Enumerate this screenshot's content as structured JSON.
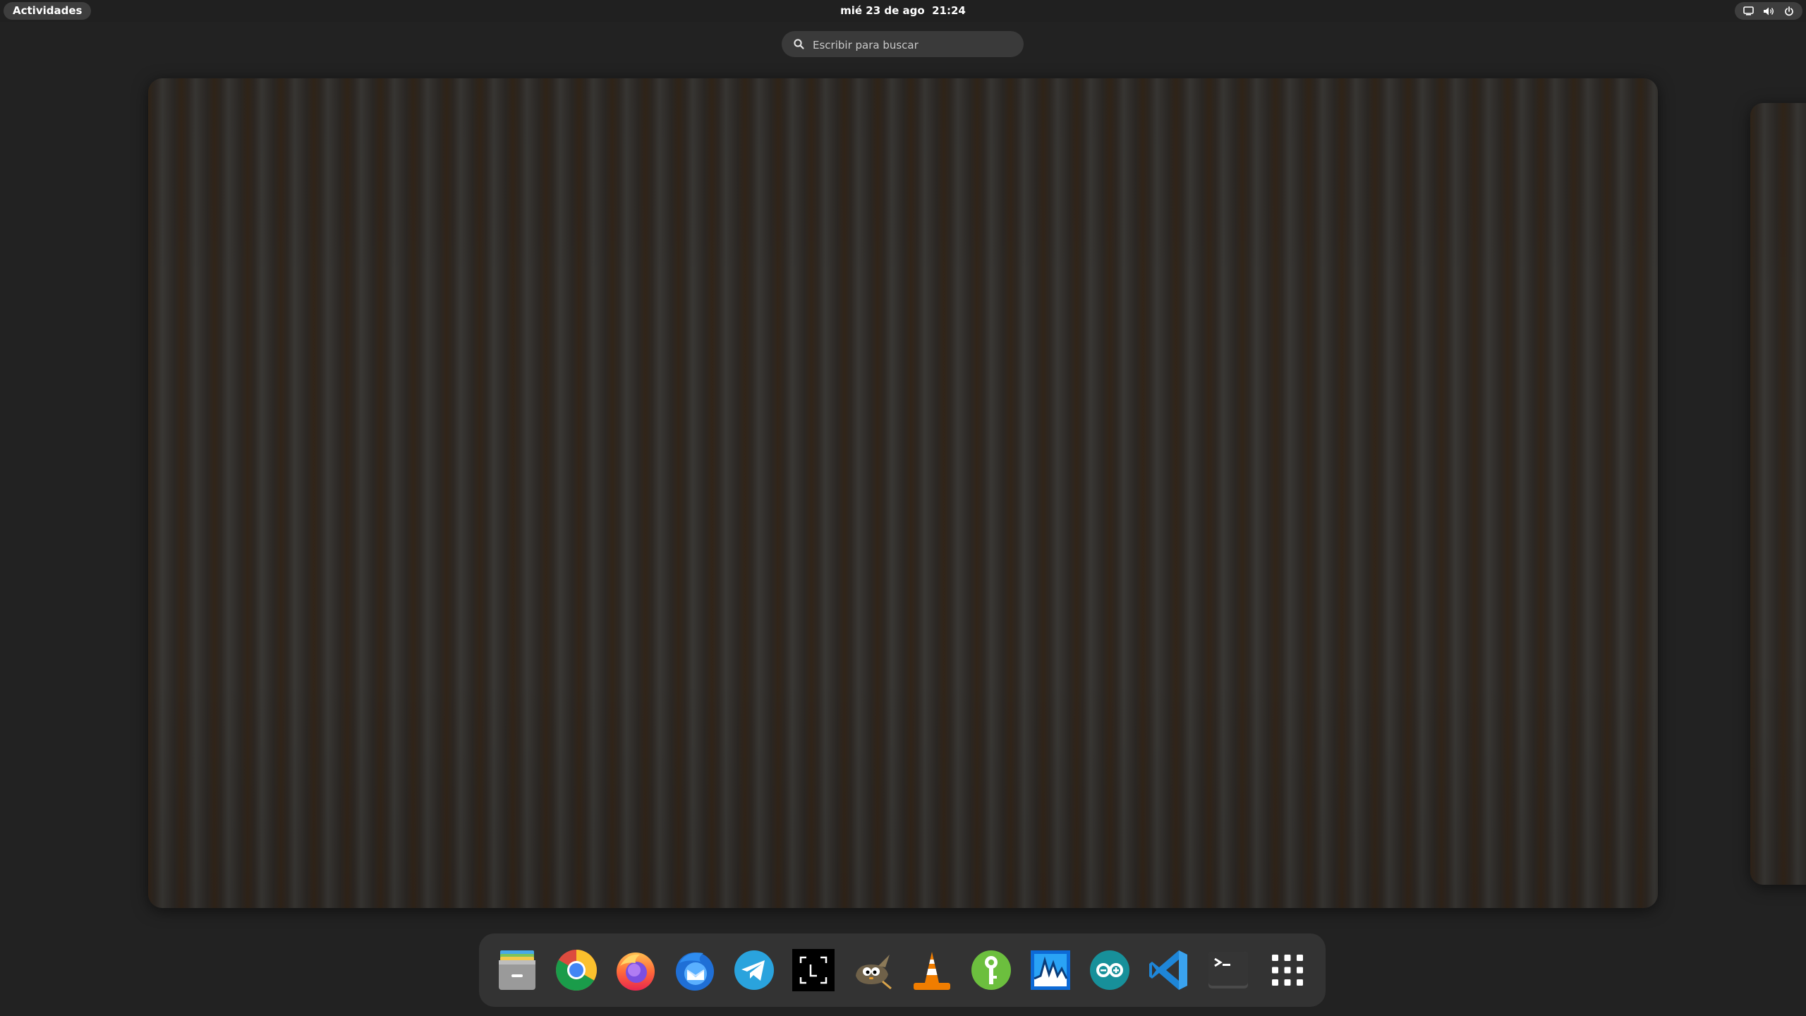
{
  "topbar": {
    "activities_label": "Actividades",
    "clock": "mié 23 de ago  21:24",
    "status_icons": [
      "screen-icon",
      "volume-icon",
      "power-icon"
    ]
  },
  "search": {
    "placeholder": "Escribir para buscar",
    "icon": "search-icon"
  },
  "workspaces": [
    {
      "name": "workspace-1",
      "wallpaper": "wood-stripes",
      "active": true
    },
    {
      "name": "workspace-2",
      "wallpaper": "wood-stripes",
      "active": false
    }
  ],
  "dock": {
    "apps": [
      {
        "id": "files",
        "icon": "files-icon"
      },
      {
        "id": "chrome",
        "icon": "chrome-icon"
      },
      {
        "id": "firefox",
        "icon": "firefox-icon"
      },
      {
        "id": "thunderbird",
        "icon": "thunderbird-icon"
      },
      {
        "id": "telegram",
        "icon": "telegram-icon"
      },
      {
        "id": "screenshot",
        "icon": "screenshot-icon"
      },
      {
        "id": "gimp",
        "icon": "gimp-icon"
      },
      {
        "id": "vlc",
        "icon": "vlc-icon"
      },
      {
        "id": "keys",
        "icon": "key-icon"
      },
      {
        "id": "wave",
        "icon": "waveform-icon"
      },
      {
        "id": "arduino",
        "icon": "arduino-icon"
      },
      {
        "id": "vscode",
        "icon": "vscode-icon"
      },
      {
        "id": "terminal",
        "icon": "terminal-icon"
      },
      {
        "id": "app-grid",
        "icon": "app-grid-icon"
      }
    ]
  },
  "colors": {
    "panel_bg": "#202020",
    "overview_bg": "#222222",
    "pill_bg": "#3e3e3e",
    "search_bg": "#3a3a3a",
    "dock_bg": "#333333",
    "wood_light": "#e1c29b",
    "wood_dark": "#7e5733"
  }
}
